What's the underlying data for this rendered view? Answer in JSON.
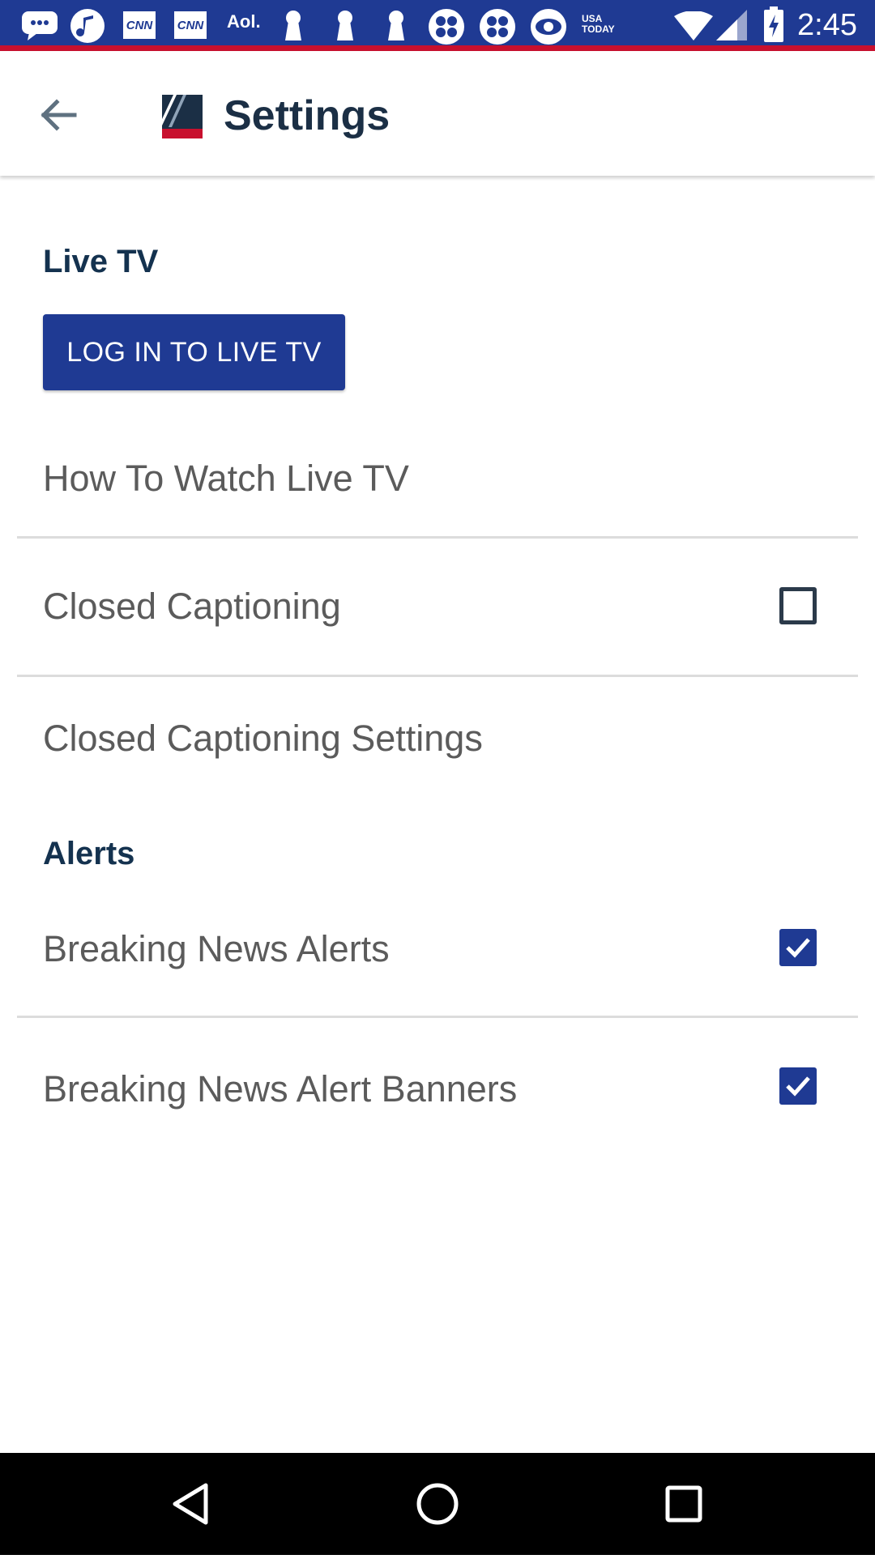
{
  "status_bar": {
    "time": "2:45",
    "notification_icons": [
      "chat-bubble-icon",
      "music-note-icon",
      "cnn-icon",
      "cnn-icon",
      "aol-icon",
      "keyhole-icon",
      "keyhole-icon",
      "keyhole-icon",
      "cbs-eye-icon",
      "cbs-eye-icon",
      "usa-today-icon"
    ],
    "cnn_label": "CNN",
    "aol_label": "Aol.",
    "usa_today_label_1": "USA",
    "usa_today_label_2": "TODAY"
  },
  "app_bar": {
    "title": "Settings",
    "back_icon": "arrow-left-icon",
    "logo_icon": "app-logo-icon"
  },
  "live_tv": {
    "header": "Live TV",
    "login_button": "LOG IN TO LIVE TV",
    "how_to_watch": "How To Watch Live TV",
    "closed_captioning": "Closed Captioning",
    "closed_captioning_checked": false,
    "closed_captioning_settings": "Closed Captioning Settings"
  },
  "alerts": {
    "header": "Alerts",
    "breaking_news_alerts": "Breaking News Alerts",
    "breaking_news_alerts_checked": true,
    "breaking_news_alert_banners": "Breaking News Alert Banners",
    "breaking_news_alert_banners_checked": true
  },
  "colors": {
    "primary_blue": "#1f3a93",
    "accent_red": "#c8102e",
    "header_text": "#14324f"
  }
}
